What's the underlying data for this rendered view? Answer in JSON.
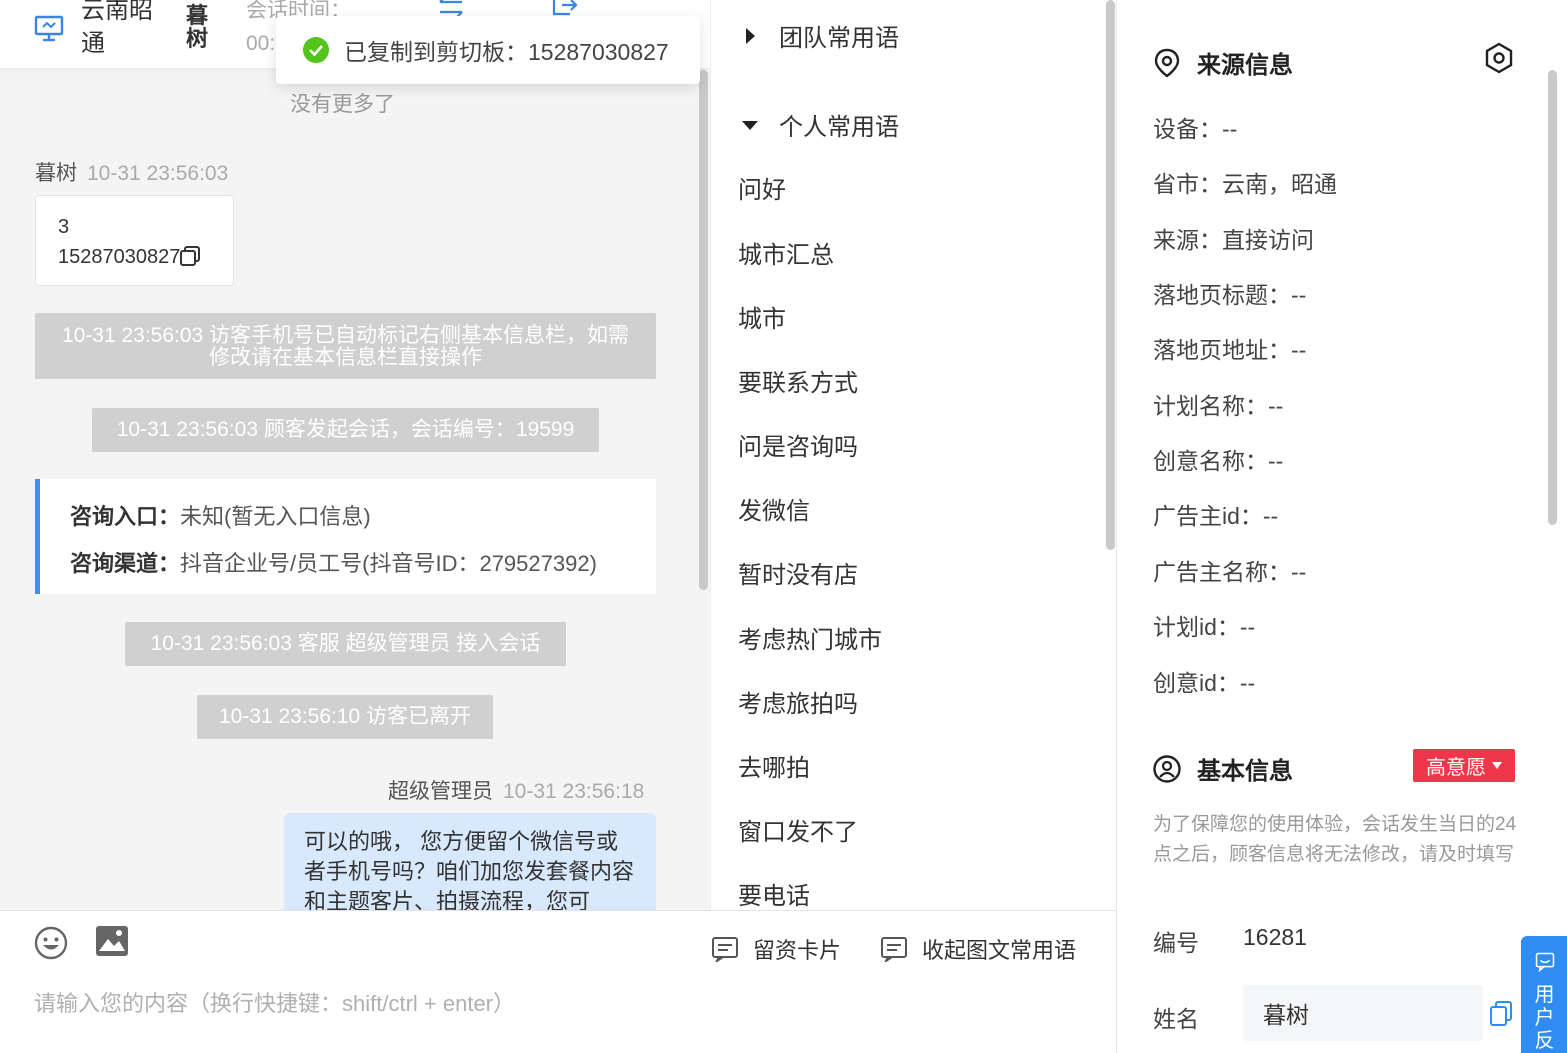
{
  "header": {
    "location": "云南昭通",
    "visitor_name": "暮树",
    "session_time_label": "会话时间：",
    "session_time_value": "00:"
  },
  "toast": {
    "text": "已复制到剪切板：15287030827"
  },
  "chat": {
    "no_more": "没有更多了",
    "first_msg": {
      "sender": "暮树",
      "time": "10-31 23:56:03",
      "line1": "3",
      "line2": "15287030827"
    },
    "system": [
      "10-31 23:56:03 访客手机号已自动标记右侧基本信息栏，如需修改请在基本信息栏直接操作",
      "10-31 23:56:03 顾客发起会话，会话编号：19599",
      "10-31 23:56:03 客服 超级管理员 接入会话",
      "10-31 23:56:10 访客已离开"
    ],
    "entry": {
      "entry_label": "咨询入口：",
      "entry_value": "未知(暂无入口信息)",
      "channel_label": "咨询渠道：",
      "channel_value": "抖音企业号/员工号(抖音号ID：279527392)"
    },
    "agent_msg": {
      "sender": "超级管理员",
      "time": "10-31 23:56:18",
      "text": "可以的哦， 您方便留个微信号或者手机号吗？咱们加您发套餐内容和主题客片、拍摄流程，您可"
    }
  },
  "input": {
    "card_label": "留资卡片",
    "collapse_label": "收起图文常用语",
    "placeholder": "请输入您的内容（换行快捷键：shift/ctrl + enter）"
  },
  "phrases": {
    "team_group": "团队常用语",
    "personal_group": "个人常用语",
    "items": [
      "问好",
      "城市汇总",
      "城市",
      "要联系方式",
      "问是咨询吗",
      "发微信",
      "暂时没有店",
      "考虑热门城市",
      "考虑旅拍吗",
      "去哪拍",
      "窗口发不了",
      "要电话"
    ]
  },
  "source_info": {
    "title": "来源信息",
    "rows": [
      "设备：--",
      "省市：云南，昭通",
      "来源：直接访问",
      "落地页标题：--",
      "落地页地址：--",
      "计划名称：--",
      "创意名称：--",
      "广告主id：--",
      "广告主名称：--",
      "计划id：--",
      "创意id：--"
    ]
  },
  "basic_info": {
    "title": "基本信息",
    "intent": "高意愿",
    "notice": "为了保障您的使用体验，会话发生当日的24点之后，顾客信息将无法修改，请及时填写",
    "id_label": "编号",
    "id_value": "16281",
    "name_label": "姓名",
    "name_value": "暮树"
  },
  "feedback": {
    "label": "用户反"
  },
  "colors": {
    "accent_blue": "#2f8cf3",
    "intent_red": "#f0364a",
    "bubble_blue": "#d8e8fd",
    "success_green": "#52c41a"
  }
}
